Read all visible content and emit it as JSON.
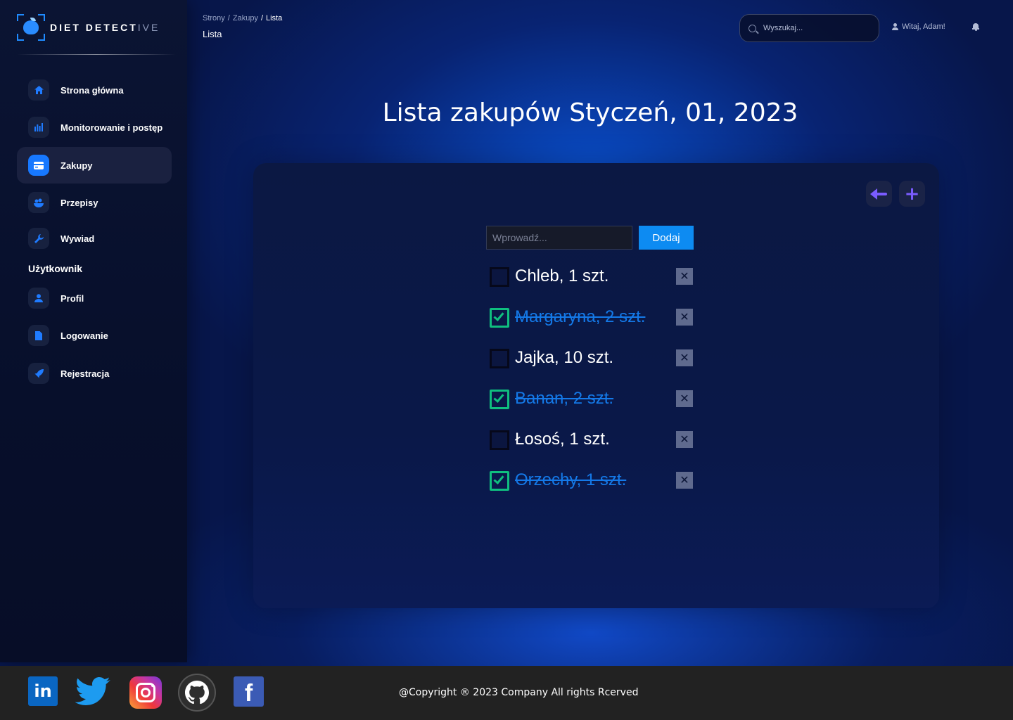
{
  "brand": {
    "name_bright": "DIET DETECT",
    "name_dim": "IVE"
  },
  "sidebar": {
    "items": [
      {
        "label": "Strona główna",
        "icon": "home-icon"
      },
      {
        "label": "Monitorowanie i postęp",
        "icon": "bar-chart-icon"
      },
      {
        "label": "Zakupy",
        "icon": "credit-card-icon",
        "active": true
      },
      {
        "label": "Przepisy",
        "icon": "recipes-icon"
      },
      {
        "label": "Wywiad",
        "icon": "wrench-icon"
      }
    ],
    "section_user": "Użytkownik",
    "user_items": [
      {
        "label": "Profil",
        "icon": "person-icon"
      },
      {
        "label": "Logowanie",
        "icon": "document-icon"
      },
      {
        "label": "Rejestracja",
        "icon": "rocket-icon"
      }
    ]
  },
  "header": {
    "breadcrumb": [
      "Strony",
      "Zakupy",
      "Lista"
    ],
    "page_name": "Lista",
    "search_placeholder": "Wyszukaj...",
    "greeting": "Witaj, Adam!"
  },
  "main": {
    "title": "Lista zakupów Styczeń, 01, 2023",
    "entry_placeholder": "Wprowadź...",
    "add_label": "Dodaj",
    "items": [
      {
        "text": "Chleb, 1 szt.",
        "checked": false
      },
      {
        "text": "Margaryna, 2 szt.",
        "checked": true
      },
      {
        "text": "Jajka, 10 szt.",
        "checked": false
      },
      {
        "text": "Banan, 2 szt.",
        "checked": true
      },
      {
        "text": "Łosoś, 1 szt.",
        "checked": false
      },
      {
        "text": "Orzechy, 1 szt.",
        "checked": true
      }
    ],
    "delete_glyph": "✕"
  },
  "footer": {
    "copyright": "@Copyright ® 2023 Company All rights Rcerved",
    "socials": [
      "linkedin-icon",
      "twitter-icon",
      "instagram-icon",
      "github-icon",
      "facebook-icon"
    ]
  },
  "colors": {
    "accent": "#1778ff",
    "checked": "#0fbf7f",
    "done_text": "#1479e8",
    "action": "#7a5cff"
  }
}
